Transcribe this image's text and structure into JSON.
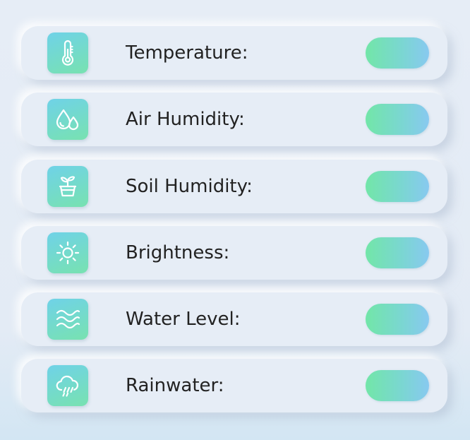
{
  "sensors": [
    {
      "icon": "thermometer-icon",
      "label": "Temperature:"
    },
    {
      "icon": "water-drops-icon",
      "label": "Air Humidity:"
    },
    {
      "icon": "plant-pot-icon",
      "label": "Soil Humidity:"
    },
    {
      "icon": "sun-icon",
      "label": "Brightness:"
    },
    {
      "icon": "waves-icon",
      "label": "Water Level:"
    },
    {
      "icon": "rain-cloud-icon",
      "label": "Rainwater:"
    }
  ],
  "colors": {
    "background": "#e6edf6",
    "icon_gradient_start": "#6fd2e8",
    "icon_gradient_end": "#78e2b0",
    "pill_gradient_start": "#72e6a8",
    "pill_gradient_end": "#88c9f0",
    "label_text": "#222222"
  }
}
